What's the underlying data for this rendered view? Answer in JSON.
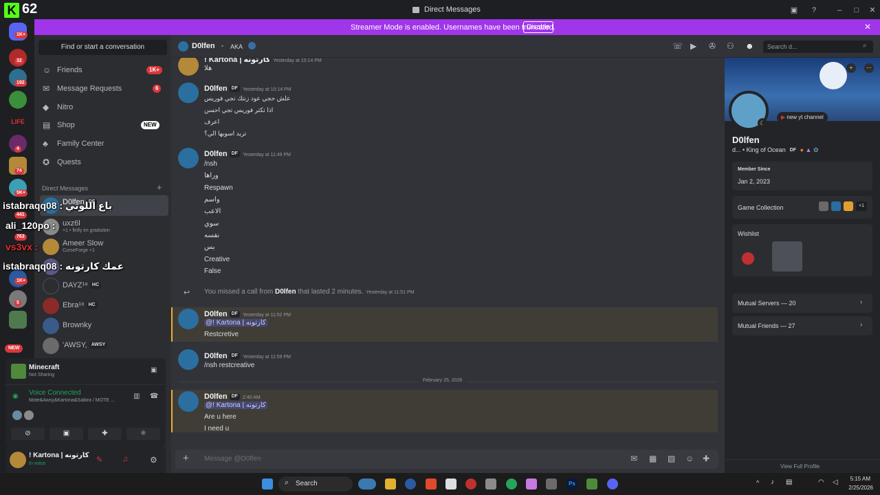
{
  "overlay": {
    "k": "K",
    "count": "62"
  },
  "window": {
    "title": "Direct Messages"
  },
  "banner": {
    "text": "Streamer Mode is enabled. Usernames have been truncated.",
    "button": "Disable"
  },
  "guild_badges": [
    "1K+",
    "32",
    "192",
    "4",
    "74",
    "5K+",
    "441",
    "763",
    "1K+",
    "5",
    "NEW"
  ],
  "sidebar": {
    "search": "Find or start a conversation",
    "nav": [
      {
        "label": "Friends",
        "badge": "1K+"
      },
      {
        "label": "Message Requests",
        "badge": "6"
      },
      {
        "label": "Nitro",
        "badge": ""
      },
      {
        "label": "Shop",
        "badge": "NEW"
      },
      {
        "label": "Family Center",
        "badge": ""
      },
      {
        "label": "Quests",
        "badge": ""
      }
    ],
    "dm_header": "Direct Messages",
    "dms": [
      {
        "name": "D0lfen",
        "tag": "DF",
        "status": ""
      },
      {
        "name": "uxz6l",
        "tag": "",
        "status": "+1 • finlly im gradution"
      },
      {
        "name": "Ameer Slow",
        "tag": "",
        "status": "CurseForge +1"
      },
      {
        "name": "",
        "tag": "",
        "status": ""
      },
      {
        "name": "DAYZ¹⁹",
        "tag": "HC",
        "status": ""
      },
      {
        "name": "Ebra¹⁹",
        "tag": "HC",
        "status": ""
      },
      {
        "name": "Brownky",
        "tag": "",
        "status": ""
      },
      {
        "name": "'AWSY,",
        "tag": "AWSY",
        "status": ""
      }
    ]
  },
  "stream_overlay": {
    "l1": "istabraqq08 : باع اللوتي",
    "l2": "ali_120po :",
    "l3": "vs3vx :",
    "l4": "istabraqq08 : عمك كارتونه"
  },
  "activity": {
    "game": "Minecraft",
    "state": "Not Sharing",
    "voice": "Voice Connected",
    "voice_channel": "Mote&Awsy&Kartona&Sabira / MOTE ..."
  },
  "user": {
    "name": "! Kartona | كارتونه",
    "status": "In voice"
  },
  "chat_header": {
    "name": "D0lfen",
    "aka": "AKA",
    "search_placeholder": "Search d..."
  },
  "messages": {
    "m0": {
      "author": "! Kartona | كارتونه",
      "time": "Yesterday at 10:14 PM",
      "lines": [
        "هلا"
      ]
    },
    "m1": {
      "author": "D0lfen",
      "tag": "DF",
      "time": "Yesterday at 10:14 PM",
      "lines": [
        "علش حجي عود زنتك تجي فوريس",
        "اذا تكتر فوريس تجي احسن",
        "اعرف",
        "تريد اسويها الي؟"
      ]
    },
    "m2": {
      "author": "D0lfen",
      "tag": "DF",
      "time": "Yesterday at 11:49 PM",
      "lines": [
        "/nsh",
        "وراها",
        "Respawn",
        "واسم",
        "الاعب",
        "سوي",
        "نفسه",
        "بس",
        "Creative",
        "False"
      ]
    },
    "call": {
      "pre": "You missed a call from",
      "who": "D0lfen",
      "post": "that lasted 2 minutes.",
      "time": "Yesterday at 11:51 PM"
    },
    "m3": {
      "author": "D0lfen",
      "tag": "DF",
      "time": "Yesterday at 11:52 PM",
      "mention": "@! Kartona | كارتونه",
      "lines": [
        "Restcretive"
      ]
    },
    "m4": {
      "author": "D0lfen",
      "tag": "DF",
      "time": "Yesterday at 11:59 PM",
      "lines": [
        "/nsh restcreative"
      ]
    },
    "divider": "February 25, 2026",
    "m5": {
      "author": "D0lfen",
      "tag": "DF",
      "time": "2:40 AM",
      "mention": "@! Kartona | كارتونه",
      "lines": [
        "Are u here",
        "I need u"
      ]
    }
  },
  "composer": {
    "placeholder": "Message @D0lfen"
  },
  "profile": {
    "status_note": "new yt channel",
    "name": "D0lfen",
    "sub": "d... • King of Ocean",
    "tag": "DF",
    "member_since_label": "Member Since",
    "member_since": "Jan 2, 2023",
    "game_collection": "Game Collection",
    "game_more": "+1",
    "wishlist": "Wishlist",
    "mutual_servers": "Mutual Servers — 20",
    "mutual_friends": "Mutual Friends — 27",
    "view_full": "View Full Profile"
  },
  "taskbar": {
    "search": "Search",
    "time": "5:15 AM",
    "date": "2/25/2026"
  },
  "colors": {
    "accent": "#5865f2",
    "banner": "#a035ea",
    "badge": "#da373c",
    "voice": "#23a55a"
  }
}
